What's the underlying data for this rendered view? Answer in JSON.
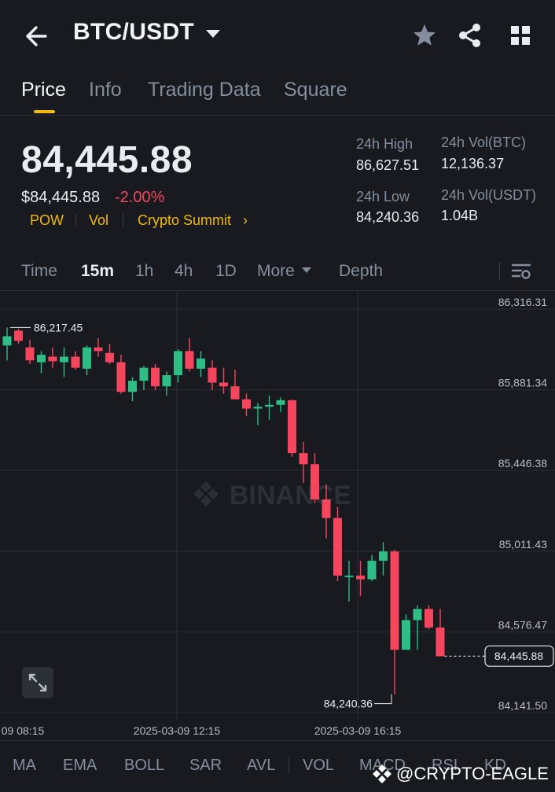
{
  "header": {
    "title": "BTC/USDT",
    "back_icon": "arrow-left-icon",
    "favorite_icon": "star-icon",
    "share_icon": "share-icon",
    "grid_icon": "grid-icon"
  },
  "tabs": [
    {
      "label": "Price",
      "active": true
    },
    {
      "label": "Info",
      "active": false
    },
    {
      "label": "Trading Data",
      "active": false
    },
    {
      "label": "Square",
      "active": false
    }
  ],
  "ticker": {
    "last_price": "84,445.88",
    "usd_price": "$84,445.88",
    "change": "-2.00%",
    "tags": [
      "POW",
      "Vol",
      "Crypto Summit"
    ],
    "tag_arrow": "›",
    "high_label": "24h High",
    "high_value": "86,627.51",
    "low_label": "24h Low",
    "low_value": "84,240.36",
    "vol_btc_label": "24h Vol(BTC)",
    "vol_btc_value": "12,136.37",
    "vol_usdt_label": "24h Vol(USDT)",
    "vol_usdt_value": "1.04B"
  },
  "timeframes": [
    {
      "label": "Time",
      "active": false
    },
    {
      "label": "15m",
      "active": true
    },
    {
      "label": "1h",
      "active": false
    },
    {
      "label": "4h",
      "active": false
    },
    {
      "label": "1D",
      "active": false
    },
    {
      "label": "More",
      "active": false
    },
    {
      "label": "Depth",
      "active": false
    }
  ],
  "chart_settings_icon": "chart-settings-icon",
  "chart_data": {
    "type": "candlestick",
    "watermark": "BINANCE",
    "y_ticks": [
      "86,316.31",
      "85,881.34",
      "85,446.38",
      "85,011.43",
      "84,576.47",
      "84,141.50"
    ],
    "y_tick_values": [
      86316.31,
      85881.34,
      85446.38,
      85011.43,
      84576.47,
      84141.5
    ],
    "ylim": [
      84141.5,
      86316.31
    ],
    "x_ticks": [
      "09 08:15",
      "2025-03-09 12:15",
      "2025-03-09 16:15"
    ],
    "high_marker": "86,217.45",
    "high_marker_value": 86217.45,
    "low_marker": "84,240.36",
    "low_marker_value": 84240.36,
    "last_price_label": "84,445.88",
    "last_price_value": 84445.88,
    "colors": {
      "up": "#2ebd85",
      "down": "#f6465d"
    },
    "candles": [
      {
        "o": 86120,
        "h": 86217,
        "l": 86040,
        "c": 86170
      },
      {
        "o": 86200,
        "h": 86210,
        "l": 86130,
        "c": 86145
      },
      {
        "o": 86110,
        "h": 86150,
        "l": 86020,
        "c": 86040
      },
      {
        "o": 86030,
        "h": 86090,
        "l": 85970,
        "c": 86070
      },
      {
        "o": 86060,
        "h": 86110,
        "l": 86000,
        "c": 86035
      },
      {
        "o": 86030,
        "h": 86110,
        "l": 85950,
        "c": 86060
      },
      {
        "o": 86060,
        "h": 86090,
        "l": 85990,
        "c": 86000
      },
      {
        "o": 85995,
        "h": 86120,
        "l": 85960,
        "c": 86110
      },
      {
        "o": 86110,
        "h": 86160,
        "l": 86060,
        "c": 86090
      },
      {
        "o": 86080,
        "h": 86130,
        "l": 86020,
        "c": 86030
      },
      {
        "o": 86030,
        "h": 86070,
        "l": 85860,
        "c": 85870
      },
      {
        "o": 85870,
        "h": 85950,
        "l": 85820,
        "c": 85930
      },
      {
        "o": 85930,
        "h": 86010,
        "l": 85880,
        "c": 86000
      },
      {
        "o": 86000,
        "h": 86020,
        "l": 85880,
        "c": 85900
      },
      {
        "o": 85900,
        "h": 85980,
        "l": 85850,
        "c": 85960
      },
      {
        "o": 85960,
        "h": 86100,
        "l": 85920,
        "c": 86090
      },
      {
        "o": 86090,
        "h": 86160,
        "l": 85980,
        "c": 85995
      },
      {
        "o": 85995,
        "h": 86090,
        "l": 85950,
        "c": 86050
      },
      {
        "o": 86000,
        "h": 86040,
        "l": 85880,
        "c": 85920
      },
      {
        "o": 85920,
        "h": 86000,
        "l": 85860,
        "c": 85900
      },
      {
        "o": 85900,
        "h": 85990,
        "l": 85830,
        "c": 85830
      },
      {
        "o": 85830,
        "h": 85860,
        "l": 85740,
        "c": 85780
      },
      {
        "o": 85780,
        "h": 85810,
        "l": 85690,
        "c": 85790
      },
      {
        "o": 85790,
        "h": 85850,
        "l": 85720,
        "c": 85800
      },
      {
        "o": 85800,
        "h": 85840,
        "l": 85760,
        "c": 85825
      },
      {
        "o": 85825,
        "h": 85830,
        "l": 85520,
        "c": 85540
      },
      {
        "o": 85540,
        "h": 85600,
        "l": 85380,
        "c": 85480
      },
      {
        "o": 85480,
        "h": 85540,
        "l": 85270,
        "c": 85290
      },
      {
        "o": 85290,
        "h": 85370,
        "l": 85080,
        "c": 85190
      },
      {
        "o": 85190,
        "h": 85250,
        "l": 84850,
        "c": 84880
      },
      {
        "o": 84880,
        "h": 84960,
        "l": 84740,
        "c": 84880
      },
      {
        "o": 84880,
        "h": 84960,
        "l": 84770,
        "c": 84860
      },
      {
        "o": 84860,
        "h": 84990,
        "l": 84850,
        "c": 84960
      },
      {
        "o": 84960,
        "h": 85060,
        "l": 84880,
        "c": 85010
      },
      {
        "o": 85010,
        "h": 85020,
        "l": 84240,
        "c": 84480
      },
      {
        "o": 84480,
        "h": 84670,
        "l": 84480,
        "c": 84640
      },
      {
        "o": 84640,
        "h": 84720,
        "l": 84480,
        "c": 84700
      },
      {
        "o": 84700,
        "h": 84720,
        "l": 84590,
        "c": 84600
      },
      {
        "o": 84600,
        "h": 84700,
        "l": 84445,
        "c": 84445
      }
    ]
  },
  "expand_icon": "expand-icon",
  "indicators": [
    "MA",
    "EMA",
    "BOLL",
    "SAR",
    "AVL",
    "VOL",
    "MACD",
    "RSI",
    "KD"
  ],
  "watermark_text": "@CRYPTO-EAGLE"
}
